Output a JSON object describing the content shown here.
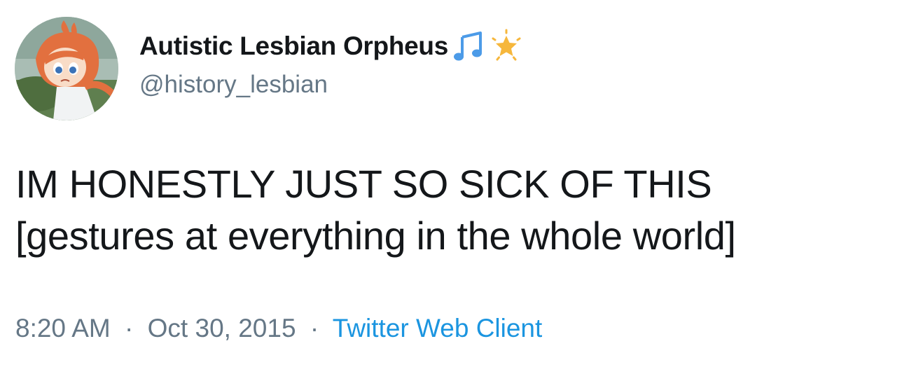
{
  "user": {
    "display_name": "Autistic Lesbian Orpheus",
    "handle": "@history_lesbian",
    "name_emojis": [
      "music-notes-icon",
      "glowing-star-icon"
    ]
  },
  "tweet": {
    "lines": [
      "IM HONESTLY JUST SO SICK OF THIS",
      "[gestures at everything in the whole world]"
    ]
  },
  "meta": {
    "time": "8:20 AM",
    "separator": "·",
    "date": "Oct 30, 2015",
    "source": "Twitter Web Client"
  },
  "colors": {
    "text": "#14171a",
    "secondary": "#657786",
    "link": "#1b95e0"
  }
}
